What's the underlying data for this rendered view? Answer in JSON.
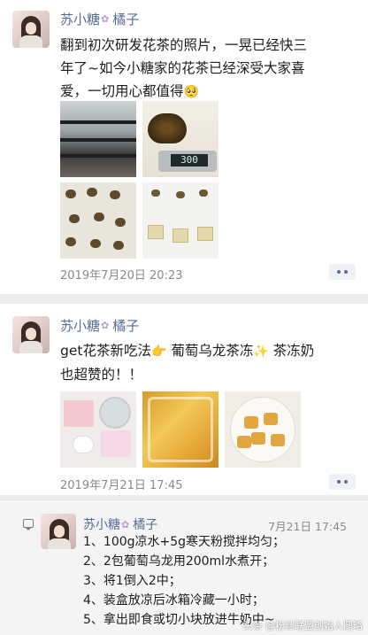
{
  "post1": {
    "author": "苏小糖",
    "flower_emoji": "✿",
    "author_suffix": "橘子",
    "text_line1": "翻到初次研发花茶的照片，一晃已经快三",
    "text_line2": "年了~如今小糖家的花茶已经深受大家喜",
    "text_line3": "爱，一切用心都值得",
    "text_emoji": "🥺",
    "timestamp": "2019年7月20日  20:23"
  },
  "post2": {
    "author": "苏小糖",
    "flower_emoji": "✿",
    "author_suffix": "橘子",
    "text_line1_a": "get花茶新吃法",
    "text_emoji1": "👉",
    "text_line1_b": " 葡萄乌龙茶冻",
    "text_emoji2": "✨",
    "text_line1_c": " 茶冻奶",
    "text_line2": "也超赞的！！",
    "timestamp": "2019年7月21日  17:45"
  },
  "comment": {
    "author": "苏小糖",
    "flower_emoji": "✿",
    "author_suffix": "橘子",
    "time": "7月21日  17:45",
    "lines": [
      "1、100g凉水+5g寒天粉搅拌均匀；",
      "2、2包葡萄乌龙用200ml水煮开；",
      "3、将1倒入2中；",
      "4、装盒放凉后冰箱冷藏一小时；",
      "5、拿出即食或切小块放进牛奶中~"
    ]
  },
  "photo_scale_reading": "300",
  "watermark": "头条 @粉丝联盟创始人鼎略",
  "colors": {
    "username": "#576b95",
    "timestamp": "#8a8a8a",
    "background": "#ececec"
  },
  "icons": [
    "more-dots-icon",
    "comment-bubble-icon",
    "flower-emoji-icon"
  ]
}
